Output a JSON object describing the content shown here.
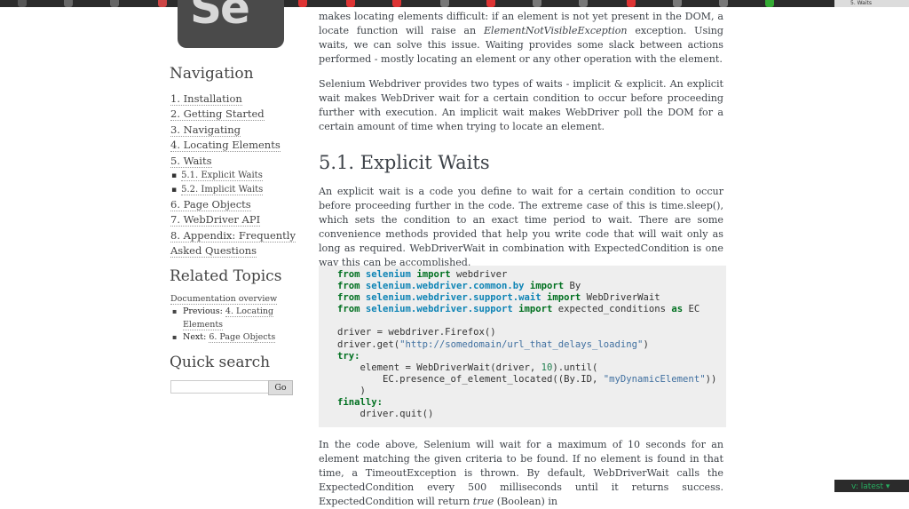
{
  "browser": {
    "active_tab_label": "5. Waits"
  },
  "sidebar": {
    "logo_text": "Se",
    "navigation_heading": "Navigation",
    "nav_items": [
      {
        "label": "1. Installation"
      },
      {
        "label": "2. Getting Started"
      },
      {
        "label": "3. Navigating"
      },
      {
        "label": "4. Locating Elements"
      },
      {
        "label": "5. Waits"
      },
      {
        "label": "5.1. Explicit Waits"
      },
      {
        "label": "5.2. Implicit Waits"
      },
      {
        "label": "6. Page Objects"
      },
      {
        "label": "7. WebDriver API"
      },
      {
        "label": "8. Appendix: Frequently Asked Questions"
      }
    ],
    "related_heading": "Related Topics",
    "related_overview": "Documentation overview",
    "previous_label": "Previous:",
    "previous_link": "4. Locating Elements",
    "next_label": "Next:",
    "next_link": "6. Page Objects",
    "search_heading": "Quick search",
    "search_value": "",
    "search_button": "Go"
  },
  "main": {
    "para1_a": "makes locating elements difficult: if an element is not yet present in the DOM, a locate function will raise an ",
    "para1_exception": "ElementNotVisibleException",
    "para1_b": " exception. Using waits, we can solve this issue. Waiting provides some slack between actions performed - mostly locating an element or any other operation with the element.",
    "para2": "Selenium Webdriver provides two types of waits - implicit & explicit. An explicit wait makes WebDriver wait for a certain condition to occur before proceeding further with execution. An implicit wait makes WebDriver poll the DOM for a certain amount of time when trying to locate an element.",
    "section_title": "5.1. Explicit Waits",
    "para3": "An explicit wait is a code you define to wait for a certain condition to occur before proceeding further in the code. The extreme case of this is time.sleep(), which sets the condition to an exact time period to wait. There are some convenience methods provided that help you write code that will wait only as long as required. WebDriverWait in combination with ExpectedCondition is one way this can be accomplished.",
    "para4_a": "In the code above, Selenium will wait for a maximum of 10 seconds for an element matching the given criteria to be found. If no element is found in that time, a TimeoutException is thrown. By default, WebDriverWait calls the ExpectedCondition every 500 milliseconds until it returns success. ExpectedCondition will return ",
    "para4_true": "true",
    "para4_b": " (Boolean) in"
  },
  "code": {
    "kw_from": "from",
    "kw_import": "import",
    "kw_as": "as",
    "kw_try": "try:",
    "kw_finally": "finally:",
    "mod1": "selenium",
    "name1": " webdriver",
    "mod2": "selenium.webdriver.common.by",
    "name2": " By",
    "mod3": "selenium.webdriver.support.wait",
    "name3": " WebDriverWait",
    "mod4": "selenium.webdriver.support",
    "name4": " expected_conditions ",
    "alias4": " EC",
    "l6": "driver = webdriver.Firefox()",
    "l7_a": "driver.get(",
    "l7_str": "\"http://somedomain/url_that_delays_loading\"",
    "l7_b": ")",
    "l9_a": "    element = WebDriverWait(driver, ",
    "l9_num": "10",
    "l9_b": ").until(",
    "l10_a": "        EC.presence_of_element_located((By.ID, ",
    "l10_str": "\"myDynamicElement\"",
    "l10_b": "))",
    "l11": "    )",
    "l13": "    driver.quit()"
  },
  "footer": {
    "version_badge": "v: latest ▾"
  },
  "colors": {
    "keyword": "#007020",
    "module": "#0e84b5",
    "string": "#4070a0",
    "number": "#208050",
    "code_bg": "#eeeeee",
    "badge_text": "#27ae60"
  },
  "icons": [
    "browser-tab-favicon",
    "selenium-logo",
    "square-bullet-icon",
    "chevron-down-icon"
  ]
}
